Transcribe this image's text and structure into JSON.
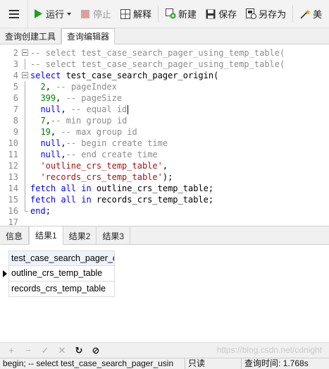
{
  "toolbar": {
    "run": "运行",
    "stop": "停止",
    "explain": "解释",
    "new": "新建",
    "save": "保存",
    "save_as": "另存为",
    "beautify": "美"
  },
  "doc_tabs": [
    "查询创建工具",
    "查询编辑器"
  ],
  "editor": {
    "lines": [
      {
        "n": "2",
        "fold": "box",
        "html": "<span class='cm'>-- select test_case_search_pager_using_temp_table(</span>"
      },
      {
        "n": "3",
        "fold": "line",
        "html": "<span class='cm'>-- select test_case_search_pager_using_temp_table(</span>"
      },
      {
        "n": "4",
        "fold": "box",
        "html": "<span class='kw'>select</span> test_case_search_pager_origin("
      },
      {
        "n": "5",
        "fold": "line",
        "html": "  <span class='num'>2</span>, <span class='cm'>-- pageIndex</span>"
      },
      {
        "n": "6",
        "fold": "line",
        "html": "  <span class='num'>399</span>, <span class='cm'>-- pageSize</span>"
      },
      {
        "n": "7",
        "fold": "line",
        "html": "  <span class='kw'>null</span>, <span class='cm'>-- equal id</span><span class='cursor'></span>"
      },
      {
        "n": "8",
        "fold": "line",
        "html": "  <span class='num'>7</span>,<span class='cm'>-- min group id</span>"
      },
      {
        "n": "9",
        "fold": "line",
        "html": "  <span class='num'>19</span>, <span class='cm'>-- max group id</span>"
      },
      {
        "n": "10",
        "fold": "line",
        "html": "  <span class='kw'>null</span>,<span class='cm'>-- begin create time</span>"
      },
      {
        "n": "11",
        "fold": "line",
        "html": "  <span class='kw'>null</span>,<span class='cm'>-- end create time</span>"
      },
      {
        "n": "12",
        "fold": "line",
        "html": "  <span class='str'>'outline_crs_temp_table'</span>,"
      },
      {
        "n": "13",
        "fold": "line",
        "html": "  <span class='str'>'records_crs_temp_table'</span>);"
      },
      {
        "n": "14",
        "fold": "line",
        "html": "<span class='kw'>fetch all in</span> outline_crs_temp_table;"
      },
      {
        "n": "15",
        "fold": "line",
        "html": "<span class='kw'>fetch all in</span> records_crs_temp_table;"
      },
      {
        "n": "16",
        "fold": "end",
        "html": "<span class='kw'>end</span>;"
      },
      {
        "n": "17",
        "fold": "",
        "html": ""
      }
    ]
  },
  "result_tabs": [
    "信息",
    "结果1",
    "结果2",
    "结果3"
  ],
  "result_grid": {
    "header": "test_case_search_pager_o",
    "rows": [
      "outline_crs_temp_table",
      "records_crs_temp_table"
    ]
  },
  "watermark": "https://blog.csdn.net/cdnight",
  "status": {
    "sql": "begin; -- select test_case_search_pager_usin",
    "mode": "只读",
    "time": "查询时间: 1.768s"
  }
}
